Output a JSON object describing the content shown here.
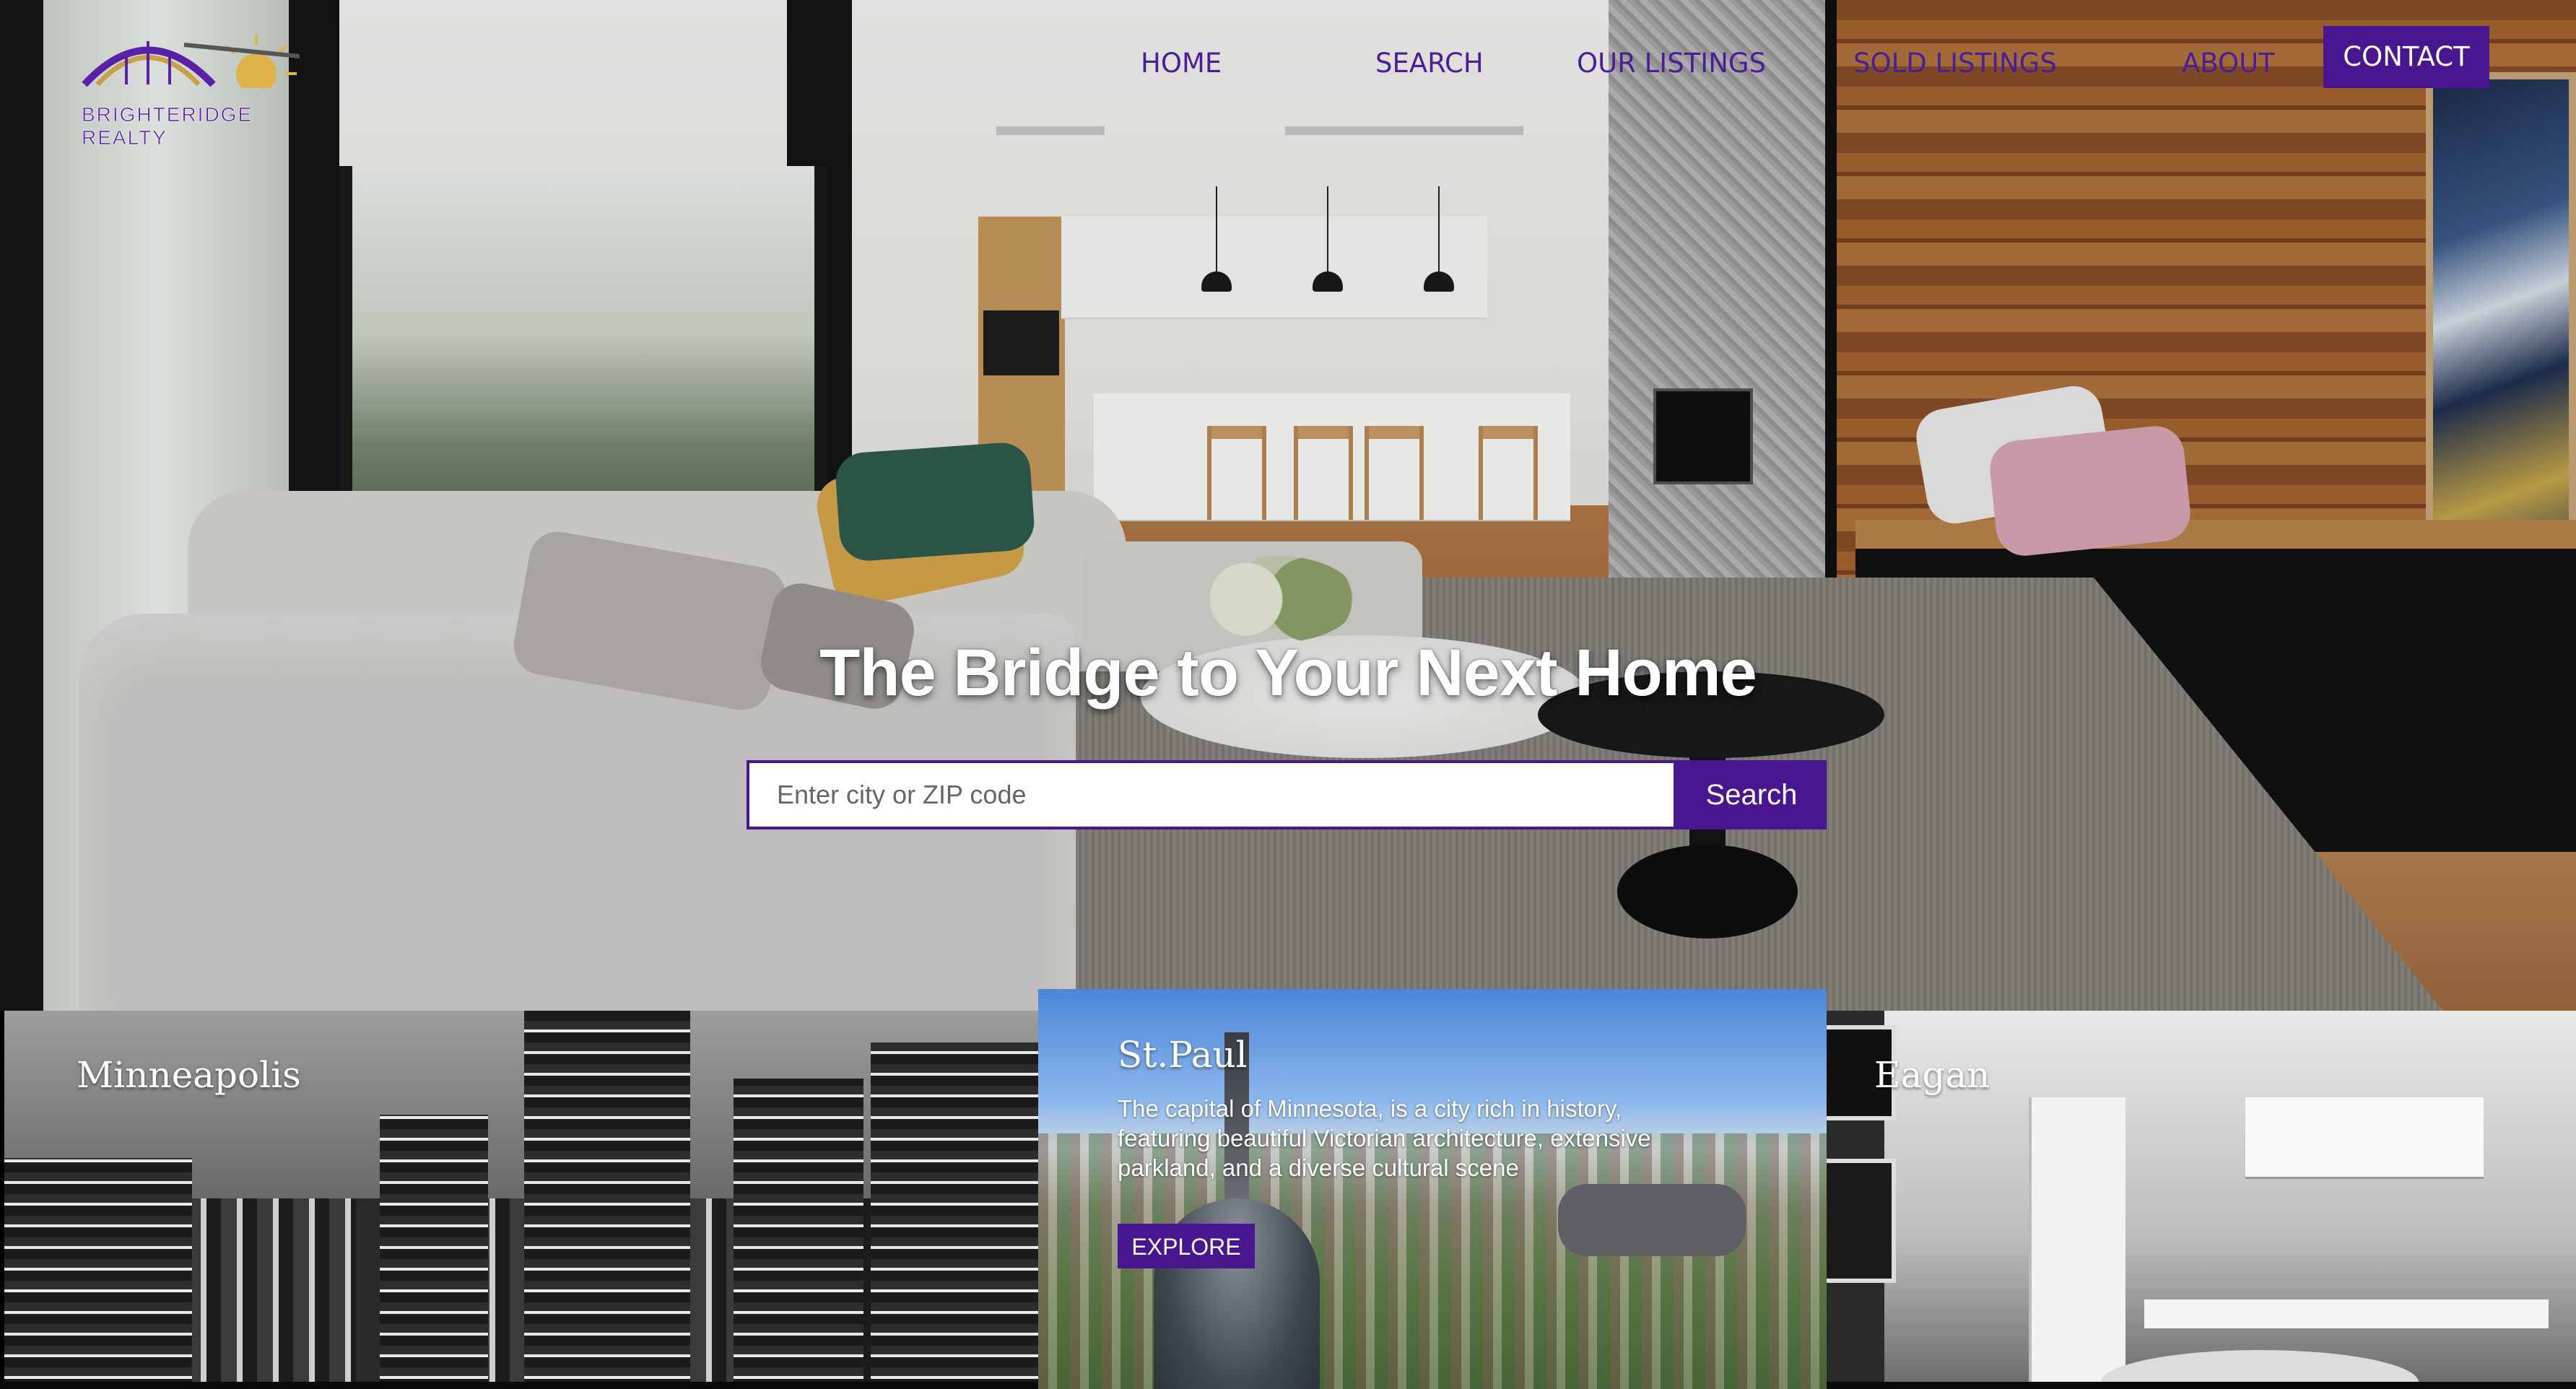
{
  "brand": {
    "name": "BRIGHTERIDGE REALTY",
    "primary_color": "#4a168f",
    "logo_icon": "bridge-sun-logo"
  },
  "nav": {
    "items": [
      {
        "label": "HOME"
      },
      {
        "label": "SEARCH"
      },
      {
        "label": "OUR LISTINGS"
      },
      {
        "label": "SOLD LISTINGS"
      },
      {
        "label": "ABOUT"
      }
    ],
    "contact_label": "CONTACT"
  },
  "hero": {
    "headline": "The Bridge to Your Next Home",
    "search": {
      "placeholder": "Enter city or ZIP code",
      "value": "",
      "button_label": "Search"
    }
  },
  "cities": [
    {
      "name": "Minneapolis"
    },
    {
      "name": "St.Paul",
      "description": "The capital of Minnesota, is a city rich in history, featuring beautiful Victorian architecture, extensive parkland, and a diverse cultural scene",
      "button_label": "EXPLORE"
    },
    {
      "name": "Eagan"
    }
  ]
}
